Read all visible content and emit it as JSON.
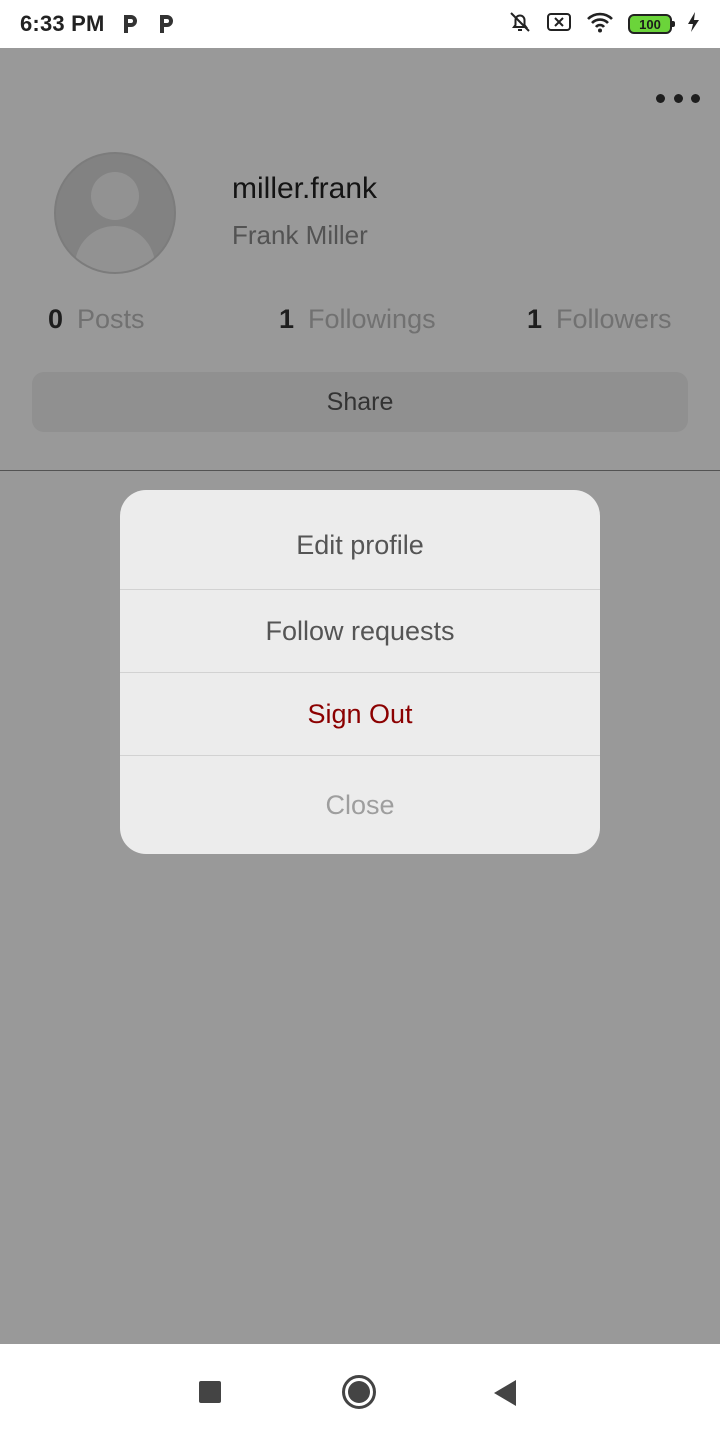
{
  "status_bar": {
    "time": "6:33 PM",
    "battery": "100",
    "icons": [
      "parking-icon",
      "parking-icon",
      "bell-off-icon",
      "sim-error-icon",
      "wifi-icon",
      "battery-icon",
      "charging-bolt-icon"
    ]
  },
  "profile": {
    "username": "miller.frank",
    "full_name": "Frank Miller",
    "stats": [
      {
        "count": "0",
        "label": "Posts"
      },
      {
        "count": "1",
        "label": "Followings"
      },
      {
        "count": "1",
        "label": "Followers"
      }
    ],
    "share_label": "Share"
  },
  "action_sheet": {
    "items": [
      {
        "label": "Edit profile"
      },
      {
        "label": "Follow requests"
      },
      {
        "label": "Sign Out"
      },
      {
        "label": "Close"
      }
    ]
  },
  "colors": {
    "danger": "#8b0000",
    "overlay": "rgba(0,0,0,0.40)",
    "sheet_bg": "#ececec",
    "battery_fill": "#6bd43a"
  },
  "nav_bar": {
    "icons": [
      "recents-square-icon",
      "home-circle-icon",
      "back-triangle-icon"
    ]
  }
}
